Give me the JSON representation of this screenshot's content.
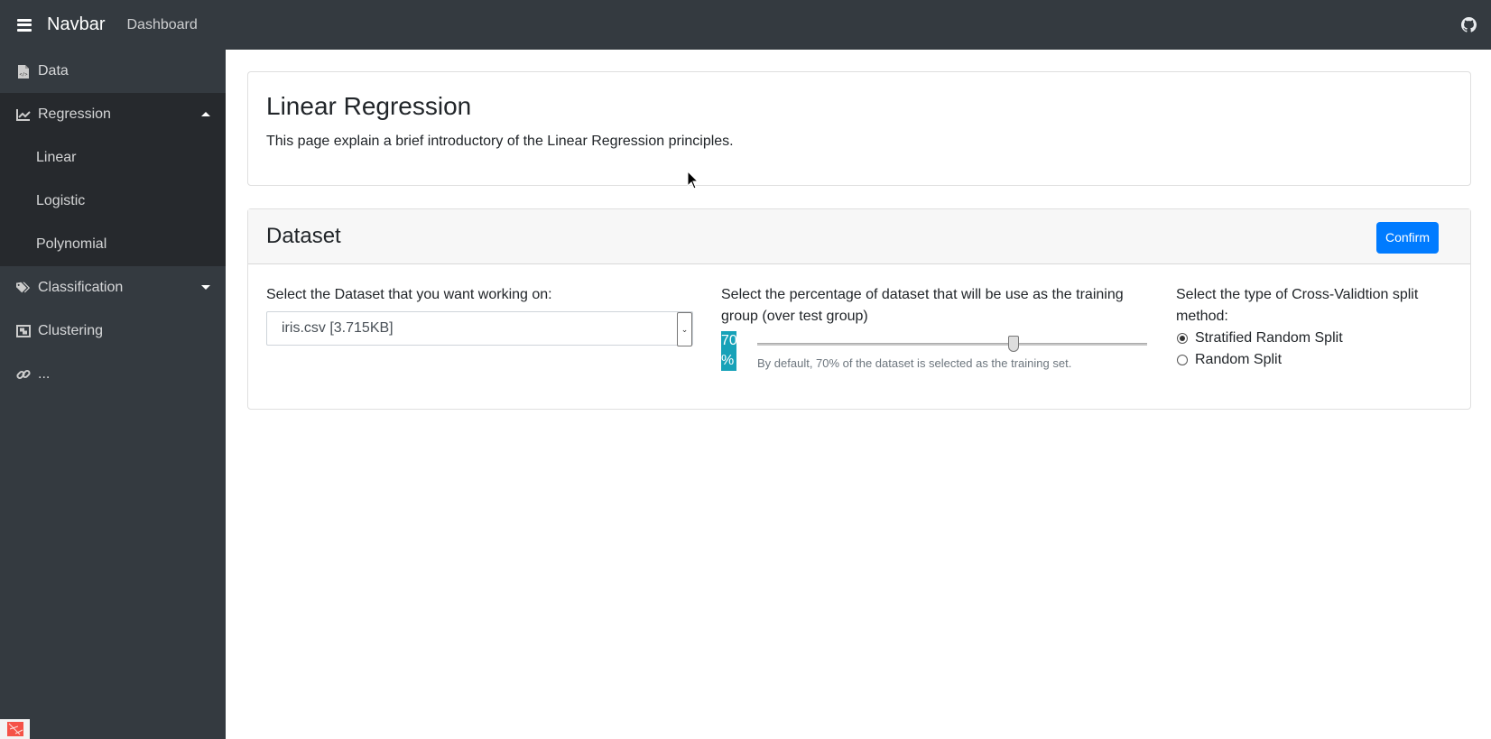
{
  "navbar": {
    "brand": "Navbar",
    "links": [
      {
        "label": "Dashboard"
      }
    ],
    "right_icon": "github-icon"
  },
  "sidebar": {
    "items": [
      {
        "label": "Data",
        "icon": "file-code-icon"
      },
      {
        "label": "Regression",
        "icon": "chart-line-icon",
        "expanded": true,
        "children": [
          {
            "label": "Linear"
          },
          {
            "label": "Logistic"
          },
          {
            "label": "Polynomial"
          }
        ]
      },
      {
        "label": "Classification",
        "icon": "tags-icon",
        "expanded": false
      },
      {
        "label": "Clustering",
        "icon": "object-group-icon"
      },
      {
        "label": "...",
        "icon": "link-icon"
      }
    ]
  },
  "intro": {
    "title": "Linear Regression",
    "text": "This page explain a brief introductory of the Linear Regression principles."
  },
  "dataset": {
    "title": "Dataset",
    "confirm_label": "Confirm",
    "select_label": "Select the Dataset that you want working on:",
    "select_value": "iris.csv [3.715KB]",
    "split_label": "Select the percentage of dataset that will be use as the training group (over test group)",
    "split_value": 70,
    "split_value_num": "70",
    "split_value_unit": "%",
    "split_min": 0,
    "split_max": 100,
    "split_help": "By default, 70% of the dataset is selected as the training set.",
    "cv_label": "Select the type of Cross-Validtion split method:",
    "cv_options": [
      {
        "label": "Stratified Random Split",
        "checked": true
      },
      {
        "label": "Random Split",
        "checked": false
      }
    ]
  },
  "colors": {
    "navbar_bg": "#343a40",
    "submenu_bg": "#26292d",
    "primary": "#007bff",
    "badge": "#17a2b8"
  }
}
